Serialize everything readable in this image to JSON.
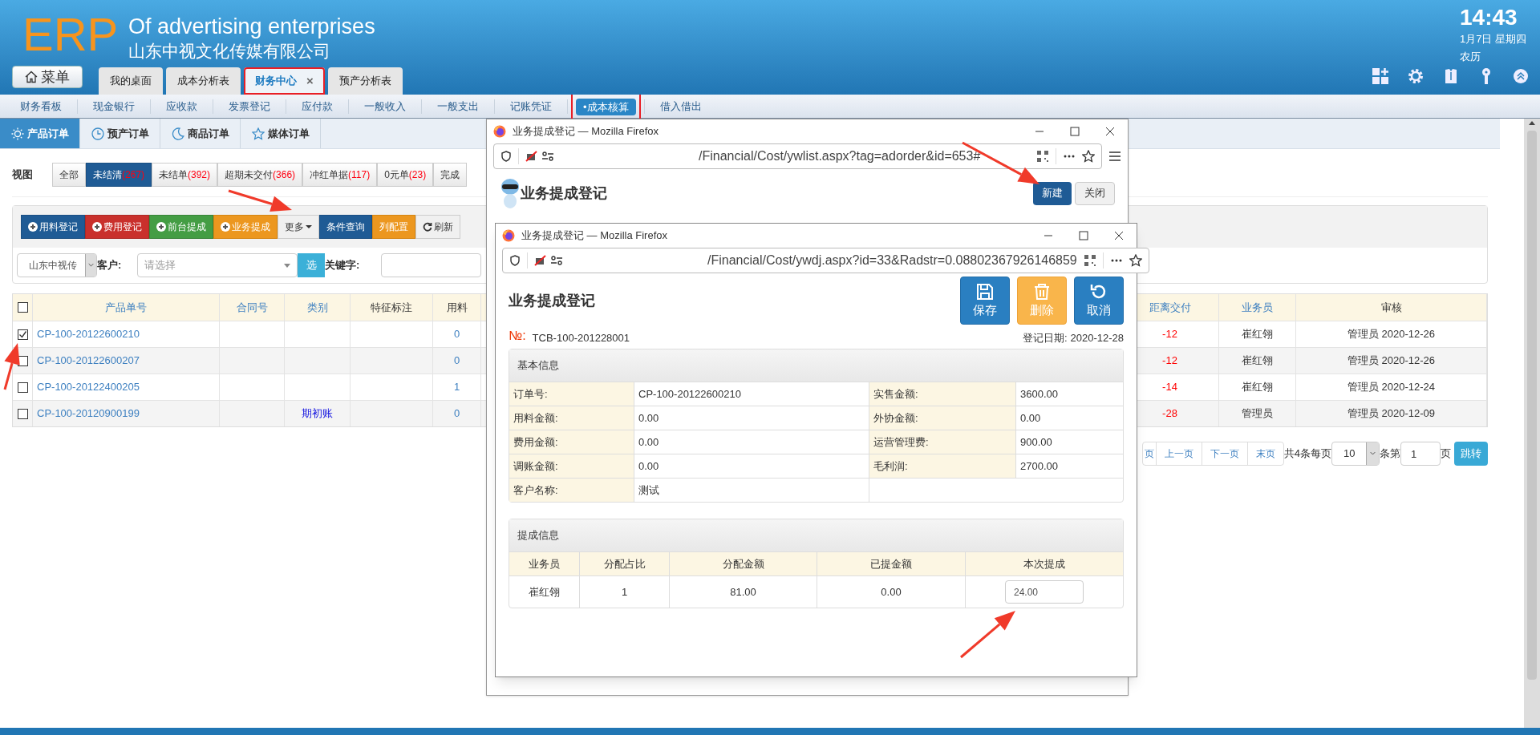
{
  "header": {
    "logo": "ERP",
    "title": "Of advertising enterprises",
    "company": "山东中视文化传媒有限公司",
    "time": "14:43",
    "date": "1月7日 星期四",
    "lunar": "农历"
  },
  "menu_button": "菜单",
  "tabs": [
    {
      "label": "我的桌面",
      "selected": false,
      "highlighted": false
    },
    {
      "label": "成本分析表",
      "selected": false,
      "highlighted": false
    },
    {
      "label": "财务中心",
      "selected": true,
      "highlighted": true,
      "close": "×"
    },
    {
      "label": "预产分析表",
      "selected": false,
      "highlighted": false
    }
  ],
  "nav": [
    {
      "label": "财务看板",
      "selected": false
    },
    {
      "label": "现金银行",
      "selected": false
    },
    {
      "label": "应收款",
      "selected": false
    },
    {
      "label": "发票登记",
      "selected": false
    },
    {
      "label": "应付款",
      "selected": false
    },
    {
      "label": "一般收入",
      "selected": false
    },
    {
      "label": "一般支出",
      "selected": false
    },
    {
      "label": "记账凭证",
      "selected": false
    },
    {
      "label": "•成本核算",
      "selected": true
    },
    {
      "label": "借入借出",
      "selected": false
    }
  ],
  "order_tabs": [
    {
      "label": "产品订单",
      "selected": true
    },
    {
      "label": "预产订单",
      "selected": false
    },
    {
      "label": "商品订单",
      "selected": false
    },
    {
      "label": "媒体订单",
      "selected": false
    }
  ],
  "views": {
    "label": "视图",
    "filters": [
      {
        "label": "全部",
        "selected": false
      },
      {
        "label": "未结清",
        "count": "(267)",
        "selected": true
      },
      {
        "label": "未结单",
        "count": "(392)",
        "selected": false
      },
      {
        "label": "超期未交付",
        "count": "(366)",
        "selected": false
      },
      {
        "label": "冲红单据",
        "count": "(117)",
        "selected": false
      },
      {
        "label": "0元单",
        "count": "(23)",
        "selected": false
      },
      {
        "label": "完成",
        "selected": false
      }
    ]
  },
  "toolbar": [
    {
      "label": "用料登记",
      "kind": "primary"
    },
    {
      "label": "费用登记",
      "kind": "danger"
    },
    {
      "label": "前台提成",
      "kind": "success"
    },
    {
      "label": "业务提成",
      "kind": "warning"
    },
    {
      "label": "更多",
      "kind": "default"
    },
    {
      "label": "条件查询",
      "kind": "primary"
    },
    {
      "label": "列配置",
      "kind": "warning"
    },
    {
      "label": "刷新",
      "kind": "default"
    }
  ],
  "filter": {
    "company": "山东中视传",
    "customer_label": "客户:",
    "customer_placeholder": "请选择",
    "pick_button": "选",
    "keyword_label": "关键字:"
  },
  "table": {
    "select_all_checked": false,
    "columns_left": [
      "产品单号",
      "合同号",
      "类别",
      "特征标注",
      "用料"
    ],
    "columns_right": [
      "距离交付",
      "业务员",
      "审核"
    ],
    "rows": [
      {
        "checked": true,
        "order": "CP-100-20122600210",
        "category": "",
        "material": "0",
        "distance": "-12",
        "salesperson": "崔红翎",
        "audit": "管理员 2020-12-26"
      },
      {
        "checked": false,
        "order": "CP-100-20122600207",
        "category": "",
        "material": "0",
        "distance": "-12",
        "salesperson": "崔红翎",
        "audit": "管理员 2020-12-26"
      },
      {
        "checked": false,
        "order": "CP-100-20122400205",
        "category": "",
        "material": "1",
        "distance": "-14",
        "salesperson": "崔红翎",
        "audit": "管理员 2020-12-24"
      },
      {
        "checked": false,
        "order": "CP-100-20120900199",
        "category": "期初账",
        "material": "0",
        "distance": "-28",
        "salesperson": "管理员",
        "audit": "管理员 2020-12-09"
      }
    ]
  },
  "pagination": {
    "buttons": [
      "页",
      "上一页",
      "下一页",
      "末页"
    ],
    "total": "共4条每页",
    "page_size": "10",
    "per": "条第",
    "page": "1",
    "page_suffix": "页",
    "go": "跳转"
  },
  "outer_window": {
    "title": "业务提成登记 — Mozilla Firefox",
    "url": "/Financial/Cost/ywlist.aspx?tag=adorder&id=653#",
    "heading": "业务提成登记",
    "new_button": "新建",
    "close_button": "关闭"
  },
  "inner_window": {
    "title": "业务提成登记 — Mozilla Firefox",
    "url": "/Financial/Cost/ywdj.aspx?id=33&Radstr=0.08802367926146859",
    "heading": "业务提成登记",
    "actions": [
      {
        "label": "保存",
        "kind": "save"
      },
      {
        "label": "删除",
        "kind": "delete"
      },
      {
        "label": "取消",
        "kind": "cancel"
      }
    ],
    "no_label": "№:",
    "number": "TCB-100-201228001",
    "date_label": "登记日期:",
    "date": "2020-12-28",
    "basic_title": "基本信息",
    "basic_rows": [
      {
        "label": "订单号:",
        "value": "CP-100-20122600210",
        "label2": "实售金额:",
        "value2": "3600.00"
      },
      {
        "label": "用料金额:",
        "value": "0.00",
        "label2": "外协金额:",
        "value2": "0.00"
      },
      {
        "label": "费用金额:",
        "value": "0.00",
        "label2": "运营管理费:",
        "value2": "900.00"
      },
      {
        "label": "调账金额:",
        "value": "0.00",
        "label2": "毛利润:",
        "value2": "2700.00"
      },
      {
        "label": "客户名称:",
        "value": "测试"
      }
    ],
    "commission_title": "提成信息",
    "commission_columns": [
      "业务员",
      "分配占比",
      "分配金额",
      "已提金额",
      "本次提成"
    ],
    "commission_rows": [
      {
        "salesperson": "崔红翎",
        "ratio": "1",
        "amount": "81.00",
        "drawn": "0.00",
        "current": "24.00"
      }
    ]
  }
}
